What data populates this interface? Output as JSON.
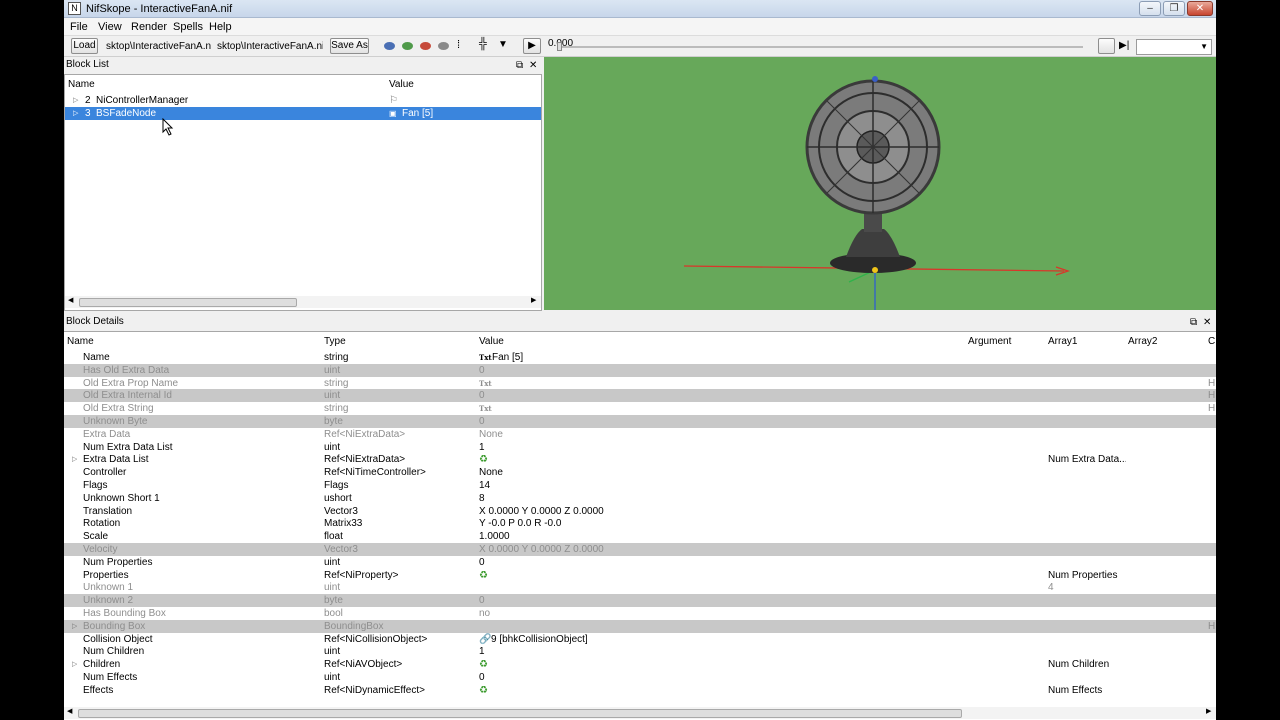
{
  "window": {
    "title": "NifSkope - InteractiveFanA.nif",
    "min": "–",
    "max": "❐",
    "close": "✕"
  },
  "menu": [
    "File",
    "View",
    "Render",
    "Spells",
    "Help"
  ],
  "toolbar": {
    "load": "Load",
    "path1": "sktop\\InteractiveFanA.nif",
    "path2": "sktop\\InteractiveFanA.nif",
    "save_as": "Save As",
    "time": "0.000"
  },
  "block_list": {
    "title": "Block List",
    "col_name": "Name",
    "col_value": "Value",
    "rows": [
      {
        "index": "2",
        "name": "NiControllerManager",
        "value": ""
      },
      {
        "index": "3",
        "name": "BSFadeNode",
        "value": "Fan [5]"
      }
    ]
  },
  "block_details": {
    "title": "Block Details",
    "headers": [
      "Name",
      "Type",
      "Value",
      "Argument",
      "Array1",
      "Array2",
      "C"
    ],
    "rows": [
      {
        "name": "Name",
        "type": "string",
        "value": "Fan [5]",
        "icon": "txt",
        "array1": "",
        "state": "normal",
        "expand": false,
        "edge": ""
      },
      {
        "name": "Has Old Extra Data",
        "type": "uint",
        "value": "0",
        "icon": "",
        "array1": "",
        "state": "dim",
        "expand": false,
        "edge": ""
      },
      {
        "name": "Old Extra Prop Name",
        "type": "string",
        "value": "",
        "icon": "txt",
        "array1": "",
        "state": "gray",
        "expand": false,
        "edge": "H"
      },
      {
        "name": "Old Extra Internal Id",
        "type": "uint",
        "value": "0",
        "icon": "",
        "array1": "",
        "state": "dim",
        "expand": false,
        "edge": "H"
      },
      {
        "name": "Old Extra String",
        "type": "string",
        "value": "",
        "icon": "txt",
        "array1": "",
        "state": "gray",
        "expand": false,
        "edge": "H"
      },
      {
        "name": "Unknown Byte",
        "type": "byte",
        "value": "0",
        "icon": "",
        "array1": "",
        "state": "dim",
        "expand": false,
        "edge": ""
      },
      {
        "name": "Extra Data",
        "type": "Ref<NiExtraData>",
        "value": "None",
        "icon": "",
        "array1": "",
        "state": "gray",
        "expand": false,
        "edge": ""
      },
      {
        "name": "Num Extra Data List",
        "type": "uint",
        "value": "1",
        "icon": "",
        "array1": "",
        "state": "normal",
        "expand": false,
        "edge": ""
      },
      {
        "name": "Extra Data List",
        "type": "Ref<NiExtraData>",
        "value": "",
        "icon": "ref",
        "array1": "Num Extra Data...",
        "state": "normal",
        "expand": true,
        "edge": ""
      },
      {
        "name": "Controller",
        "type": "Ref<NiTimeController>",
        "value": "None",
        "icon": "",
        "array1": "",
        "state": "normal",
        "expand": false,
        "edge": ""
      },
      {
        "name": "Flags",
        "type": "Flags",
        "value": "14",
        "icon": "",
        "array1": "",
        "state": "normal",
        "expand": false,
        "edge": ""
      },
      {
        "name": "Unknown Short 1",
        "type": "ushort",
        "value": "8",
        "icon": "",
        "array1": "",
        "state": "normal",
        "expand": false,
        "edge": ""
      },
      {
        "name": "Translation",
        "type": "Vector3",
        "value": "X 0.0000 Y 0.0000 Z 0.0000",
        "icon": "",
        "array1": "",
        "state": "normal",
        "expand": false,
        "edge": ""
      },
      {
        "name": "Rotation",
        "type": "Matrix33",
        "value": "Y -0.0 P 0.0 R -0.0",
        "icon": "",
        "array1": "",
        "state": "normal",
        "expand": false,
        "edge": ""
      },
      {
        "name": "Scale",
        "type": "float",
        "value": "1.0000",
        "icon": "",
        "array1": "",
        "state": "normal",
        "expand": false,
        "edge": ""
      },
      {
        "name": "Velocity",
        "type": "Vector3",
        "value": "X 0.0000 Y 0.0000 Z 0.0000",
        "icon": "",
        "array1": "",
        "state": "dim",
        "expand": false,
        "edge": ""
      },
      {
        "name": "Num Properties",
        "type": "uint",
        "value": "0",
        "icon": "",
        "array1": "",
        "state": "normal",
        "expand": false,
        "edge": ""
      },
      {
        "name": "Properties",
        "type": "Ref<NiProperty>",
        "value": "",
        "icon": "ref",
        "array1": "Num Properties",
        "state": "normal",
        "expand": false,
        "edge": ""
      },
      {
        "name": "Unknown 1",
        "type": "uint",
        "value": "",
        "icon": "",
        "array1": "4",
        "state": "gray",
        "expand": false,
        "edge": ""
      },
      {
        "name": "Unknown 2",
        "type": "byte",
        "value": "0",
        "icon": "",
        "array1": "",
        "state": "dim",
        "expand": false,
        "edge": ""
      },
      {
        "name": "Has Bounding Box",
        "type": "bool",
        "value": "no",
        "icon": "",
        "array1": "",
        "state": "gray",
        "expand": false,
        "edge": ""
      },
      {
        "name": "Bounding Box",
        "type": "BoundingBox",
        "value": "",
        "icon": "",
        "array1": "",
        "state": "dim",
        "expand": true,
        "edge": "H"
      },
      {
        "name": "Collision Object",
        "type": "Ref<NiCollisionObject>",
        "value": "9 [bhkCollisionObject]",
        "icon": "link",
        "array1": "",
        "state": "normal",
        "expand": false,
        "edge": ""
      },
      {
        "name": "Num Children",
        "type": "uint",
        "value": "1",
        "icon": "",
        "array1": "",
        "state": "normal",
        "expand": false,
        "edge": ""
      },
      {
        "name": "Children",
        "type": "Ref<NiAVObject>",
        "value": "",
        "icon": "ref",
        "array1": "Num Children",
        "state": "normal",
        "expand": true,
        "edge": ""
      },
      {
        "name": "Num Effects",
        "type": "uint",
        "value": "0",
        "icon": "",
        "array1": "",
        "state": "normal",
        "expand": false,
        "edge": ""
      },
      {
        "name": "Effects",
        "type": "Ref<NiDynamicEffect>",
        "value": "",
        "icon": "ref",
        "array1": "Num Effects",
        "state": "normal",
        "expand": false,
        "edge": ""
      }
    ]
  },
  "icons": {
    "txt": "Txt",
    "ref": "♻",
    "link": "🔗",
    "flag": "⚐",
    "node": "▣",
    "dock": "⧉",
    "close": "✕",
    "play": "▶",
    "expand": "▷"
  }
}
